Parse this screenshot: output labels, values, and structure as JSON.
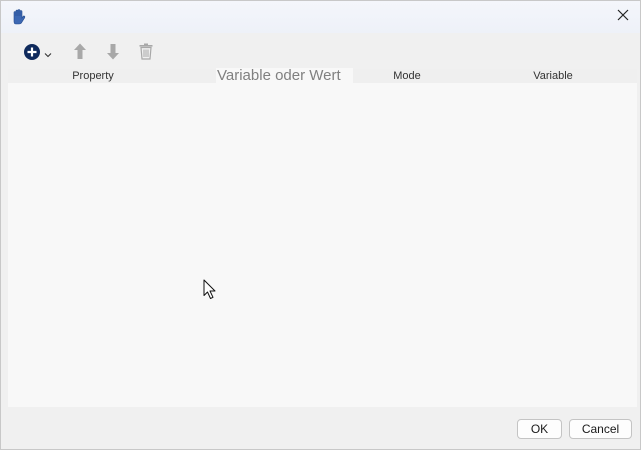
{
  "window": {
    "app_icon": "hand-icon",
    "close_icon": "close-icon"
  },
  "toolbar": {
    "add_icon": "plus-circle-icon",
    "add_dropdown_icon": "chevron-down-icon",
    "move_up_icon": "arrow-up-icon",
    "move_down_icon": "arrow-down-icon",
    "delete_icon": "trash-icon"
  },
  "grid": {
    "columns": {
      "property": "Property",
      "value": "Variable oder Wert",
      "mode": "Mode",
      "variable": "Variable"
    },
    "rows": []
  },
  "footer": {
    "ok_label": "OK",
    "cancel_label": "Cancel"
  },
  "colors": {
    "accent": "#0f2a5c",
    "icon_disabled": "#a8a8a8",
    "grid_background": "#f8f8f8"
  }
}
